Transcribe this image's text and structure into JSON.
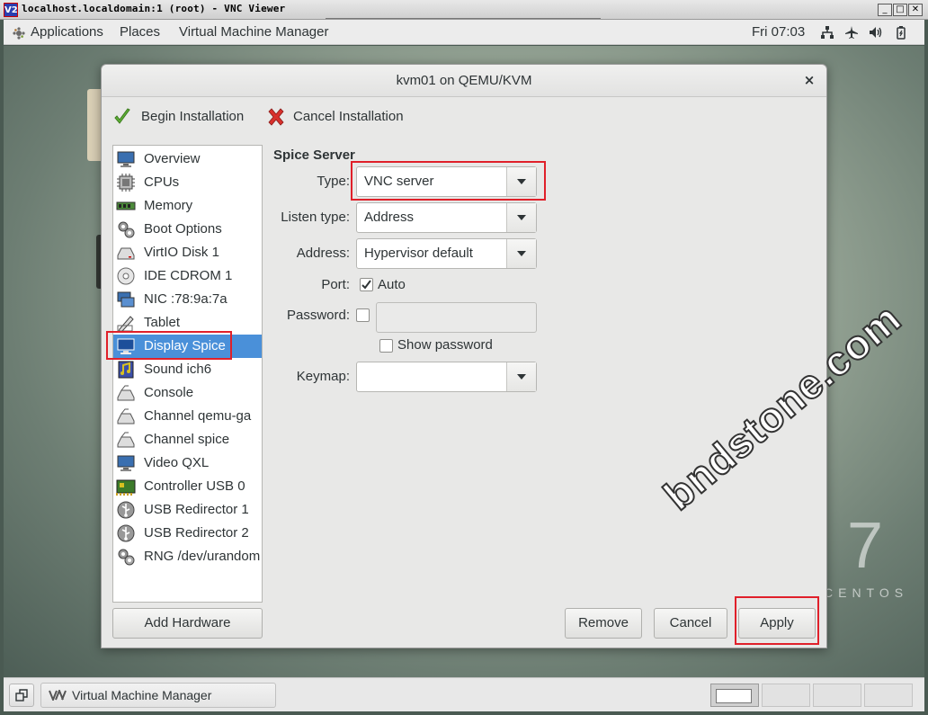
{
  "vnc": {
    "title": "localhost.localdomain:1 (root) - VNC Viewer",
    "logo": "V2",
    "buttons": {
      "minimize": "_",
      "maximize": "□",
      "close": "✕"
    }
  },
  "topbar": {
    "menus": [
      "Applications",
      "Places",
      "Virtual Machine Manager"
    ],
    "clock": "Fri 07:03",
    "tray_icons": [
      "network-icon",
      "airplane-icon",
      "volume-icon",
      "power-icon"
    ]
  },
  "desktop": {
    "centos_version": "7",
    "centos_name": "CENTOS",
    "watermark": "bndstone.com"
  },
  "dialog": {
    "title": "kvm01 on QEMU/KVM",
    "close_glyph": "×",
    "toolbar": {
      "begin": "Begin Installation",
      "cancel": "Cancel Installation"
    },
    "sidebar": [
      {
        "label": "Overview",
        "icon": "monitor-icon"
      },
      {
        "label": "CPUs",
        "icon": "cpu-icon"
      },
      {
        "label": "Memory",
        "icon": "memory-icon"
      },
      {
        "label": "Boot Options",
        "icon": "gears-icon"
      },
      {
        "label": "VirtIO Disk 1",
        "icon": "disk-icon"
      },
      {
        "label": "IDE CDROM 1",
        "icon": "cdrom-icon"
      },
      {
        "label": "NIC :78:9a:7a",
        "icon": "network-card-icon"
      },
      {
        "label": "Tablet",
        "icon": "tablet-icon"
      },
      {
        "label": "Display Spice",
        "icon": "display-icon",
        "selected": true
      },
      {
        "label": "Sound ich6",
        "icon": "sound-icon"
      },
      {
        "label": "Console",
        "icon": "serial-icon"
      },
      {
        "label": "Channel qemu-ga",
        "icon": "channel-icon"
      },
      {
        "label": "Channel spice",
        "icon": "channel-icon"
      },
      {
        "label": "Video QXL",
        "icon": "video-icon"
      },
      {
        "label": "Controller USB 0",
        "icon": "controller-icon"
      },
      {
        "label": "USB Redirector 1",
        "icon": "usb-icon"
      },
      {
        "label": "USB Redirector 2",
        "icon": "usb-icon"
      },
      {
        "label": "RNG /dev/urandom",
        "icon": "gears-icon"
      }
    ],
    "add_hardware": "Add Hardware",
    "panel": {
      "title": "Spice Server",
      "type_label": "Type:",
      "type_value": "VNC server",
      "listen_label": "Listen type:",
      "listen_value": "Address",
      "address_label": "Address:",
      "address_value": "Hypervisor default",
      "port_label": "Port:",
      "port_auto_label": "Auto",
      "port_auto_checked": true,
      "password_label": "Password:",
      "password_checked": false,
      "password_value": "",
      "show_password_label": "Show password",
      "show_password_checked": false,
      "keymap_label": "Keymap:",
      "keymap_value": ""
    },
    "buttons": {
      "remove": "Remove",
      "cancel": "Cancel",
      "apply": "Apply"
    },
    "highlight_color": "#e0202a",
    "selection_color": "#4a90d9"
  },
  "taskbar": {
    "item": "Virtual Machine Manager",
    "workspaces": 4,
    "active_workspace": 1
  }
}
